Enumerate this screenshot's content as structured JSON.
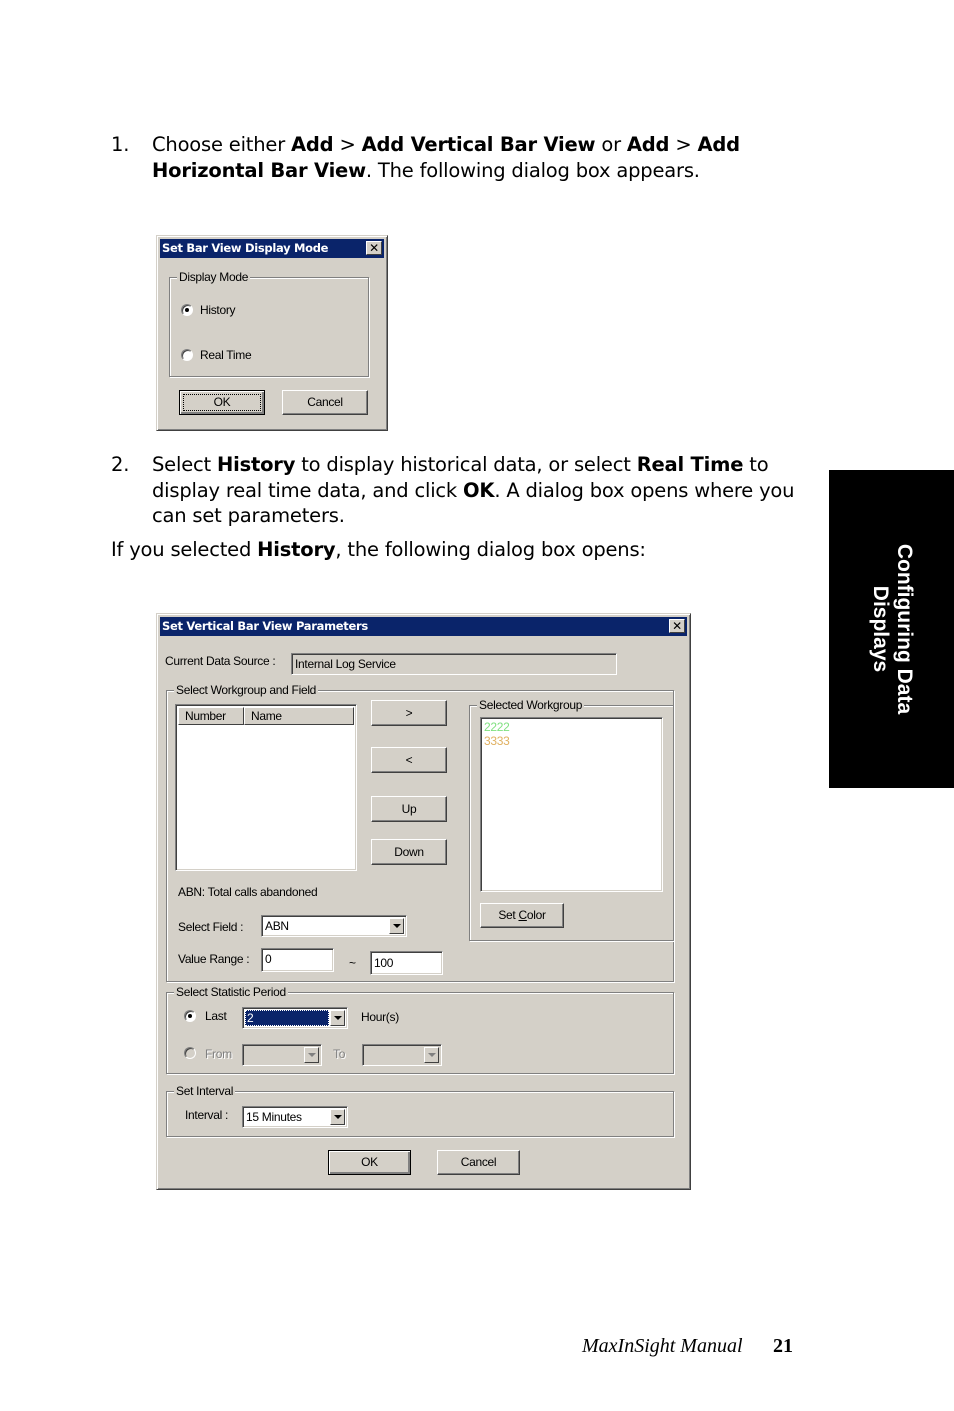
{
  "instructions": {
    "step1": {
      "number": "1.",
      "parts": [
        {
          "t": "Choose either ",
          "b": false
        },
        {
          "t": "Add",
          "b": true
        },
        {
          "t": " > ",
          "b": false
        },
        {
          "t": "Add Vertical Bar View",
          "b": true
        },
        {
          "t": " or ",
          "b": false
        },
        {
          "t": "Add",
          "b": true
        },
        {
          "t": " > ",
          "b": false
        },
        {
          "t": "Add Horizontal Bar View",
          "b": true
        },
        {
          "t": ". The following dialog box appears.",
          "b": false
        }
      ]
    },
    "step2": {
      "number": "2.",
      "parts": [
        {
          "t": "Select ",
          "b": false
        },
        {
          "t": "History",
          "b": true
        },
        {
          "t": " to display historical data, or select ",
          "b": false
        },
        {
          "t": "Real Time",
          "b": true
        },
        {
          "t": " to display real time data, and click ",
          "b": false
        },
        {
          "t": "OK",
          "b": true
        },
        {
          "t": ". A dialog box opens where you can set parameters.",
          "b": false
        }
      ]
    },
    "note": {
      "parts": [
        {
          "t": "If you selected ",
          "b": false
        },
        {
          "t": "History",
          "b": true
        },
        {
          "t": ", the following dialog box opens:",
          "b": false
        }
      ]
    }
  },
  "dialog1": {
    "title": "Set Bar View Display Mode",
    "close_glyph": "✕",
    "group_label": "Display Mode",
    "options": [
      {
        "label": "History",
        "selected": true
      },
      {
        "label": "Real Time",
        "selected": false
      }
    ],
    "ok_label": "OK",
    "cancel_label": "Cancel"
  },
  "dialog2": {
    "title": "Set Vertical Bar View Parameters",
    "close_glyph": "✕",
    "data_source_label": "Current Data Source :",
    "data_source_value": "Internal Log Service",
    "workgroup_group_label": "Select Workgroup and Field",
    "list_columns": [
      "Number",
      "Name"
    ],
    "list_rows": [],
    "add_button": ">",
    "remove_button": "<",
    "up_button": "Up",
    "down_button": "Down",
    "selected_group_label": "Selected Workgroup",
    "selected_workgroups": [
      {
        "number": "2222",
        "color": "#7fe07f"
      },
      {
        "number": "3333",
        "color": "#e0b060"
      }
    ],
    "set_color_button": "Set Color",
    "field_description": "ABN: Total calls abandoned",
    "select_field_label": "Select Field :",
    "select_field_value": "ABN",
    "value_range_label": "Value Range :",
    "value_range_min": "0",
    "value_range_sep": "~",
    "value_range_max": "100",
    "period_group_label": "Select Statistic Period",
    "last_label": "Last",
    "last_selected": true,
    "last_value": "2",
    "hours_label": "Hour(s)",
    "from_label": "From",
    "to_label": "To",
    "from_value": "",
    "to_value": "",
    "interval_group_label": "Set Interval",
    "interval_label": "Interval :",
    "interval_value": "15 Minutes",
    "ok_label": "OK",
    "cancel_label": "Cancel"
  },
  "side_tab": {
    "line1": "Configuring Data",
    "line2": "Displays"
  },
  "footer": {
    "title": "MaxInSight Manual",
    "page": "21"
  }
}
